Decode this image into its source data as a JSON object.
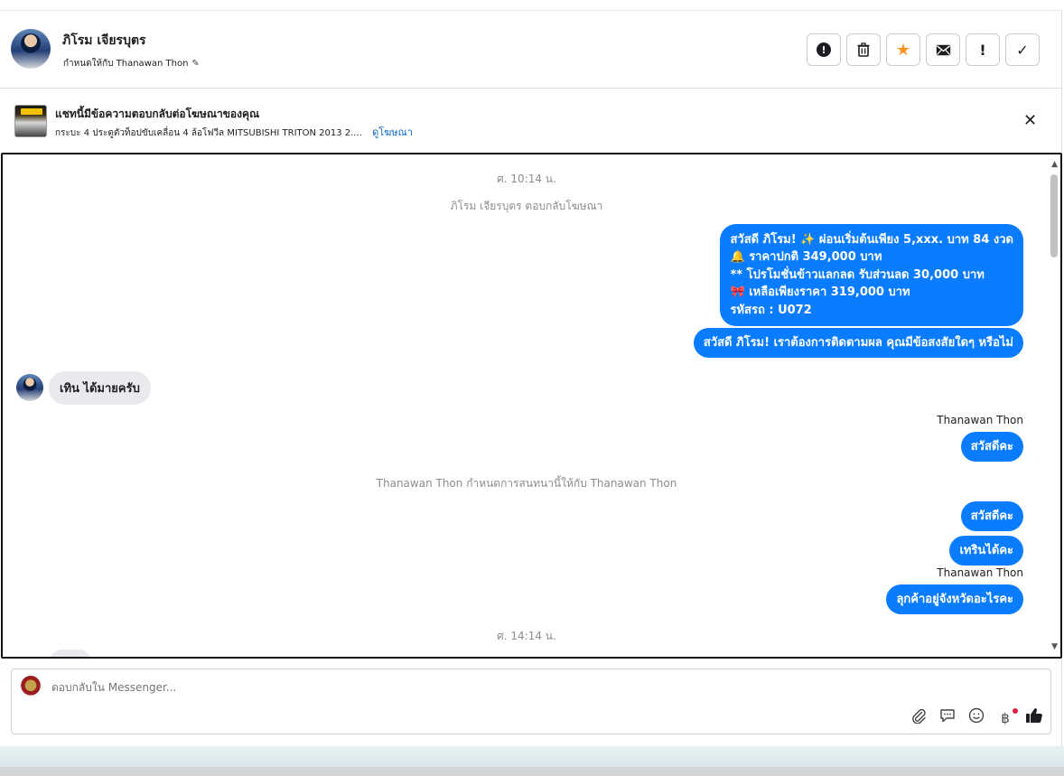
{
  "header": {
    "contact_name": "ภิโรม เจียรบุตร",
    "assigned_label": "กำหนดให้กับ Thanawan Thon",
    "actions": [
      {
        "name": "spam-icon",
        "glyph": "!"
      },
      {
        "name": "trash-icon",
        "glyph": "🗑"
      },
      {
        "name": "star-icon",
        "glyph": "★"
      },
      {
        "name": "mail-icon",
        "glyph": "✉"
      },
      {
        "name": "exclamation-icon",
        "glyph": "!"
      },
      {
        "name": "check-icon",
        "glyph": "✓"
      }
    ]
  },
  "ad_banner": {
    "title": "แชทนี้มีข้อความตอบกลับต่อโฆษณาของคุณ",
    "description": "กระบะ 4 ประตูตัวท็อปขับเคลื่อน 4 ล้อโฟวีล MITSUBISHI TRITON 2013 2....",
    "link": "ดูโฆษณา"
  },
  "chat": {
    "time_1": "ศ. 10:14 น.",
    "event_1": "ภิโรม เจียรบุตร ตอบกลับโฆษณา",
    "msg_out_1": [
      "สวัสดี ภิโรม! ✨  ผ่อนเริ่มต้นเพียง 5,xxx. บาท 84 งวด",
      "🔔 ราคาปกติ 349,000 บาท",
      "** โปรโมชั่นข้าวแลกลด รับส่วนลด 30,000 บาท",
      "🎀  เหลือเพียงราคา 319,000 บาท",
      " รหัสรถ : U072"
    ],
    "msg_out_2": "สวัสดี ภิโรม! เราต้องการติดตามผล คุณมีข้อสงสัยใดๆ หรือไม่",
    "msg_in_1": "เทิน ได้มายครับ",
    "sender_1": "Thanawan Thon",
    "msg_out_3": "สวัสดีคะ",
    "event_2": "Thanawan Thon กำหนดการสนทนานี้ให้กับ Thanawan Thon",
    "msg_out_4": "สวัสดีคะ",
    "msg_out_5": "เทรินได้คะ",
    "sender_2": "Thanawan Thon",
    "msg_out_6": "ลุกค้าอยู่จังหวัดอะไรคะ",
    "time_2": "ศ. 14:14 น."
  },
  "composer": {
    "placeholder": "ตอบกลับใน Messenger...",
    "tools": [
      "paperclip-icon",
      "chat-icon",
      "emoji-icon",
      "baht-icon",
      "thumbs-up-icon"
    ]
  }
}
